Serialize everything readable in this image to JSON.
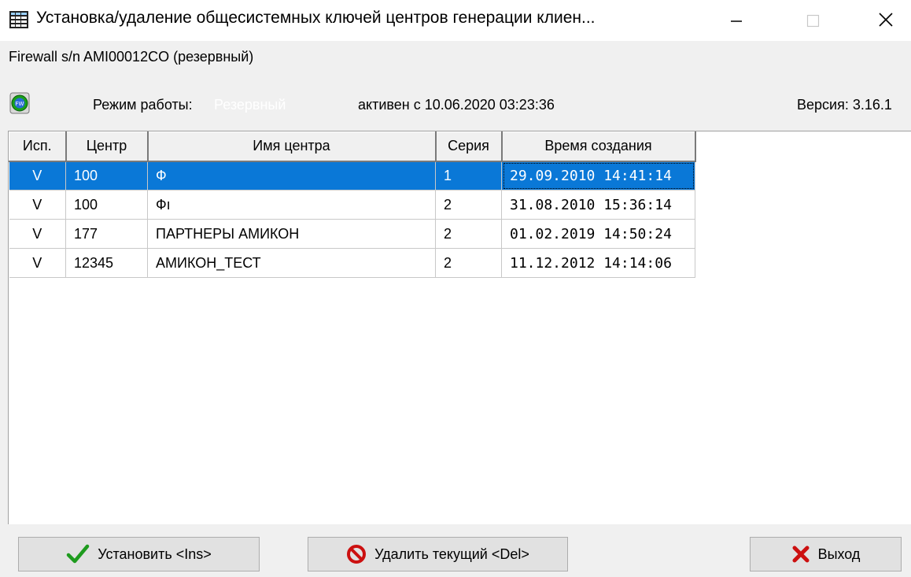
{
  "window": {
    "title": "Установка/удаление общесистемных  ключей центров генерации клиен...",
    "minimize_glyph": "minimize-icon",
    "maximize_glyph": "maximize-icon",
    "close_glyph": "close-icon"
  },
  "firewall_line": "Firewall s/n AMI00012CO (резервный)",
  "status": {
    "mode_label": "Режим работы:",
    "mode_value": "Резервный",
    "active_since": "активен с 10.06.2020 03:23:36",
    "version": "Версия: 3.16.1"
  },
  "table": {
    "columns": [
      "Исп.",
      "Центр",
      "Имя центра",
      "Серия",
      "Время создания"
    ],
    "rows": [
      {
        "use": "V",
        "center": "100",
        "name": "Ф",
        "series": "1",
        "created": "29.09.2010 14:41:14",
        "selected": true
      },
      {
        "use": "V",
        "center": "100",
        "name": "Фı",
        "series": "2",
        "created": "31.08.2010 15:36:14",
        "selected": false
      },
      {
        "use": "V",
        "center": "177",
        "name": "ПАРТНЕРЫ АМИКОН",
        "series": "2",
        "created": "01.02.2019 14:50:24",
        "selected": false
      },
      {
        "use": "V",
        "center": "12345",
        "name": "АМИКОН_ТЕСТ",
        "series": "2",
        "created": "11.12.2012 14:14:06",
        "selected": false
      }
    ]
  },
  "buttons": {
    "install": "Установить <Ins>",
    "delete": "Удалить текущий <Del>",
    "exit": "Выход"
  },
  "colors": {
    "selection": "#0a78d7",
    "install_icon": "#1e9b1e",
    "delete_icon": "#cc1010",
    "exit_icon": "#cc1010",
    "fw_icon": "#1aa01a"
  }
}
